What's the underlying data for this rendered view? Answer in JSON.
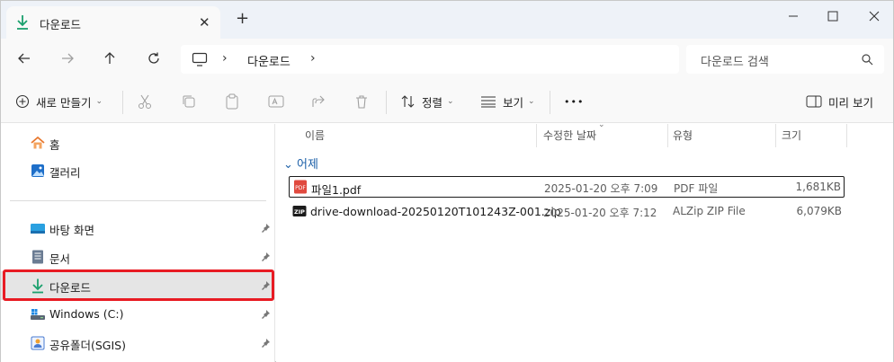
{
  "window": {
    "tab_title": "다운로드",
    "tab_close": "✕",
    "new_tab": "+"
  },
  "nav": {
    "breadcrumb_sep": "›",
    "breadcrumb": [
      "다운로드"
    ],
    "search_placeholder": "다운로드 검색"
  },
  "commands": {
    "new_label": "새로 만들기",
    "sort_label": "정렬",
    "view_label": "보기",
    "more_label": "•••",
    "preview_label": "미리 보기"
  },
  "sidebar": {
    "items": [
      {
        "label": "홈",
        "icon": "home-icon"
      },
      {
        "label": "갤러리",
        "icon": "gallery-icon"
      },
      {
        "label": "바탕 화면",
        "icon": "desktop-icon",
        "pinned": true
      },
      {
        "label": "문서",
        "icon": "documents-icon",
        "pinned": true
      },
      {
        "label": "다운로드",
        "icon": "download-icon",
        "pinned": true,
        "selected": true
      },
      {
        "label": "Windows (C:)",
        "icon": "drive-icon",
        "pinned": true
      },
      {
        "label": "공유폴더(SGIS)",
        "icon": "shared-folder-icon",
        "pinned": true
      }
    ]
  },
  "columns": {
    "name": "이름",
    "modified": "수정한 날짜",
    "type": "유형",
    "size": "크기"
  },
  "group": {
    "label": "어제",
    "chevron": "⌄"
  },
  "files": [
    {
      "name": "파일1.pdf",
      "modified": "2025-01-20 오후 7:09",
      "type": "PDF 파일",
      "size": "1,681KB",
      "icon": "pdf-file-icon"
    },
    {
      "name": "drive-download-20250120T101243Z-001.zip",
      "modified": "2025-01-20 오후 7:12",
      "type": "ALZip ZIP File",
      "size": "6,079KB",
      "icon": "zip-file-icon"
    }
  ],
  "colors": {
    "accent": "#1aa06d",
    "highlight_box": "#e81b23",
    "group_label": "#1b5fa8"
  }
}
